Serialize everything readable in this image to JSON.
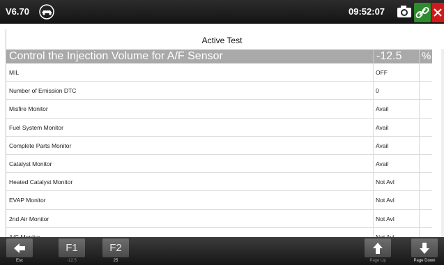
{
  "statusbar": {
    "version": "V6.70",
    "vin_icon": "vin-car-icon",
    "time": "09:52:07",
    "camera_icon": "camera-icon",
    "link_icon": "link-icon",
    "close_icon": "close-icon",
    "colors": {
      "link_bg": "#2e8b2e",
      "close_bg": "#d01a1a"
    }
  },
  "screen": {
    "title": "Active Test",
    "active_item": {
      "name": "Control the Injection Volume for A/F Sensor",
      "value": "-12.5",
      "unit": "%"
    },
    "rows": [
      {
        "name": "MIL",
        "value": "OFF"
      },
      {
        "name": "Number of Emission DTC",
        "value": "0"
      },
      {
        "name": "Misfire Monitor",
        "value": "Avail"
      },
      {
        "name": "Fuel System Monitor",
        "value": "Avail"
      },
      {
        "name": "Complete Parts Monitor",
        "value": "Avail"
      },
      {
        "name": "Catalyst Monitor",
        "value": "Avail"
      },
      {
        "name": "Heated Catalyst Monitor",
        "value": "Not Avl"
      },
      {
        "name": "EVAP Monitor",
        "value": "Not Avl"
      },
      {
        "name": "2nd Air Monitor",
        "value": "Not Avl"
      },
      {
        "name": "A/C Monitor",
        "value": "Not Avl"
      }
    ]
  },
  "toolbar": {
    "esc": {
      "icon": "arrow-left-icon",
      "label": "Esc"
    },
    "f1": {
      "key": "F1",
      "label": "-12.5"
    },
    "f2": {
      "key": "F2",
      "label": "25"
    },
    "page_up": {
      "icon": "arrow-up-icon",
      "label": "Page Up"
    },
    "page_down": {
      "icon": "arrow-down-icon",
      "label": "Page Down"
    }
  }
}
